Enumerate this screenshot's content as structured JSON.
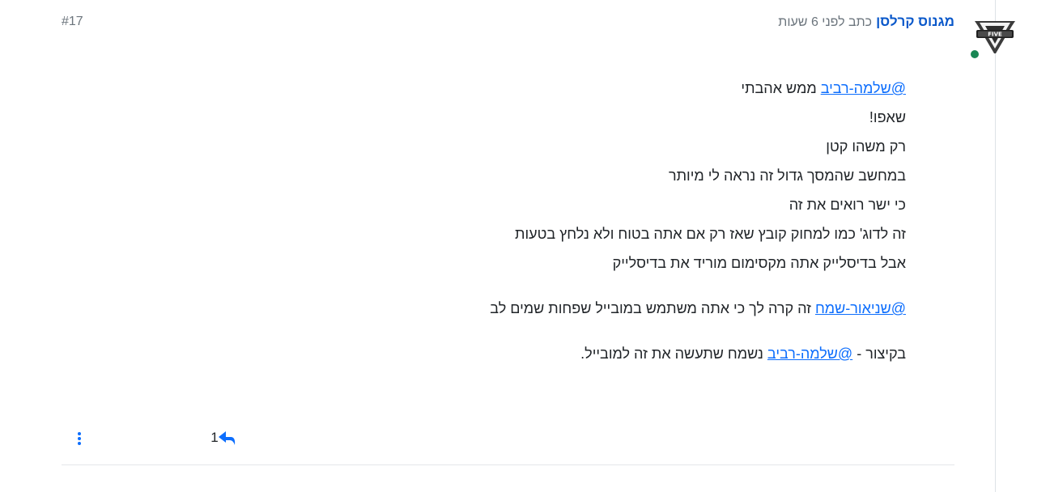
{
  "post": {
    "author": "מגנוס קרלסן",
    "meta": "כתב לפני 6 שעות",
    "index": "#17",
    "status": "online",
    "lines": [
      {
        "mention": "@שלמה-רביב",
        "text": " ממש אהבתי"
      },
      {
        "text": "שאפו!"
      },
      {
        "text": "רק משהו קטן"
      },
      {
        "text": "במחשב שהמסך גדול זה נראה לי מיותר"
      },
      {
        "text": "כי ישר רואים את זה"
      },
      {
        "text": "זה לדוג' כמו למחוק קובץ שאז רק אם אתה בטוח ולא נלחץ בטעות"
      },
      {
        "text": "אבל בדיסלייק אתה מקסימום מוריד את בדיסלייק"
      }
    ],
    "para2": {
      "mention": "@שניאור-שמח",
      "text": " זה קרה לך כי אתה משתמש במובייל שפחות שמים לב"
    },
    "para3": {
      "before": "בקיצור - ",
      "mention": "@שלמה-רביב",
      "after": " נשמח שתעשה את זה למובייל."
    },
    "votes": "1"
  },
  "colors": {
    "link": "#0d6efd",
    "author": "#0a58ca",
    "online": "#198754",
    "muted": "#6c757d"
  },
  "icons": {
    "menu": "vertical-dots-icon",
    "reply": "reply-arrow-icon"
  }
}
